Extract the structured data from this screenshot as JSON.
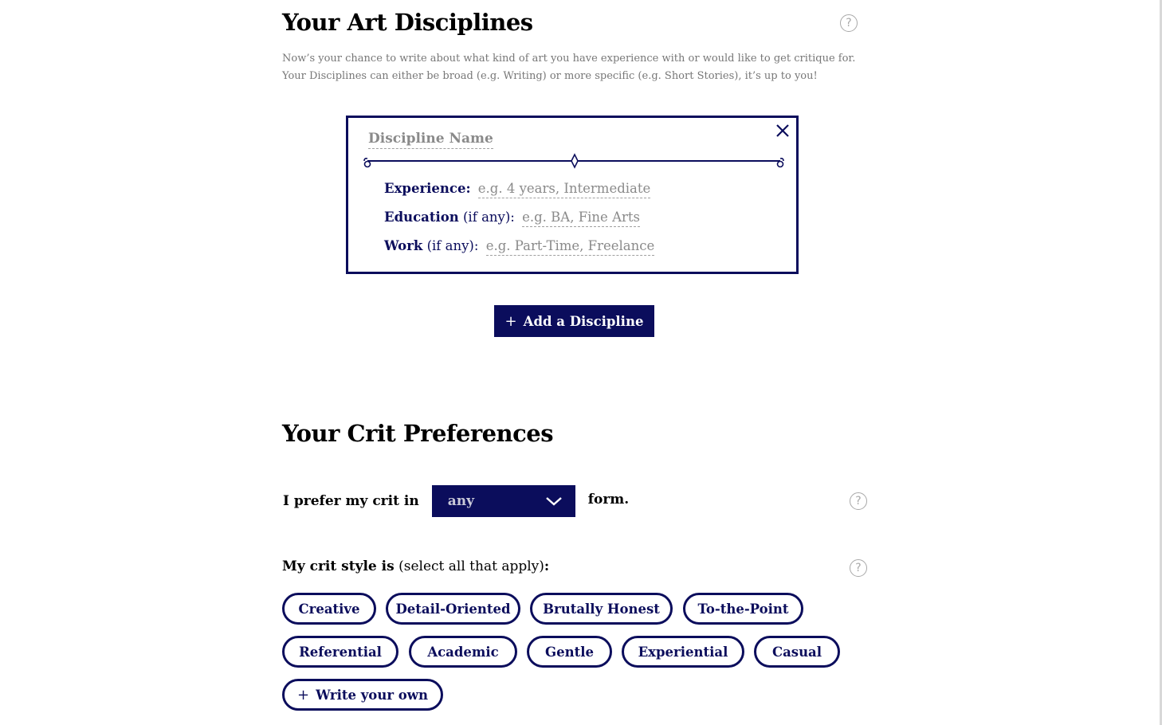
{
  "disciplines_section": {
    "title": "Your Art Disciplines",
    "help_glyph": "?",
    "intro": "Now’s your chance to write about what kind of art you have experience with or would like to get critique for. Your Disciplines can either be broad (e.g. Writing) or more specific (e.g. Short Stories), it’s up to you!",
    "card": {
      "name_placeholder": "Discipline Name",
      "experience_label": "Experience:",
      "experience_placeholder": "e.g. 4 years, Intermediate",
      "education_label": "Education",
      "education_suffix": "(if any):",
      "education_placeholder": "e.g. BA, Fine Arts",
      "work_label": "Work",
      "work_suffix": "(if any):",
      "work_placeholder": "e.g. Part-Time, Freelance"
    },
    "add_button_plus": "+",
    "add_button_label": "Add a Discipline"
  },
  "crit_section": {
    "title": "Your Crit Preferences",
    "form_prefix": "I prefer my crit in",
    "form_value": "any",
    "form_suffix": "form.",
    "style_label_bold": "My crit style is",
    "style_label_normal": "(select all that apply)",
    "style_label_colon": ":",
    "chips": [
      "Creative",
      "Detail-Oriented",
      "Brutally Honest",
      "To-the-Point",
      "Referential",
      "Academic",
      "Gentle",
      "Experiential",
      "Casual"
    ],
    "write_own_plus": "+",
    "write_own_label": "Write your own"
  },
  "icons": {
    "help": "question-circle-icon",
    "close": "close-icon",
    "dropdown": "chevron-down-icon"
  },
  "colors": {
    "navy": "#0b0d5c",
    "placeholder_gray": "#8a8a8a",
    "help_gray": "#a8a8a8"
  }
}
